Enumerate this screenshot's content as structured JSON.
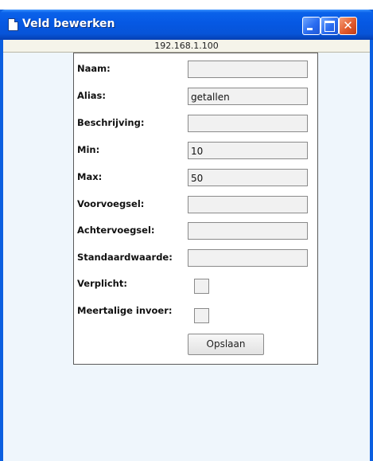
{
  "window": {
    "title": "Veld bewerken",
    "close_glyph": "✕"
  },
  "address_bar": {
    "text": "192.168.1.100"
  },
  "form": {
    "fields": [
      {
        "label": "Naam:",
        "value": ""
      },
      {
        "label": "Alias:",
        "value": "getallen"
      },
      {
        "label": "Beschrijving:",
        "value": ""
      },
      {
        "label": "Min:",
        "value": "10"
      },
      {
        "label": "Max:",
        "value": "50"
      },
      {
        "label": "Voorvoegsel:",
        "value": ""
      },
      {
        "label": "Achtervoegsel:",
        "value": ""
      },
      {
        "label": "Standaardwaarde:",
        "value": ""
      }
    ],
    "checkboxes": [
      {
        "label": "Verplicht:",
        "checked": false
      },
      {
        "label": "Meertalige invoer:",
        "checked": false
      }
    ],
    "save_label": "Opslaan"
  },
  "colors": {
    "titlebar": "#0658e3",
    "client_background": "#eff6fc",
    "close_button": "#e25a2c"
  },
  "icons": {
    "title": "document-icon",
    "minimize": "minimize-icon",
    "maximize": "maximize-icon",
    "close": "close-icon"
  }
}
